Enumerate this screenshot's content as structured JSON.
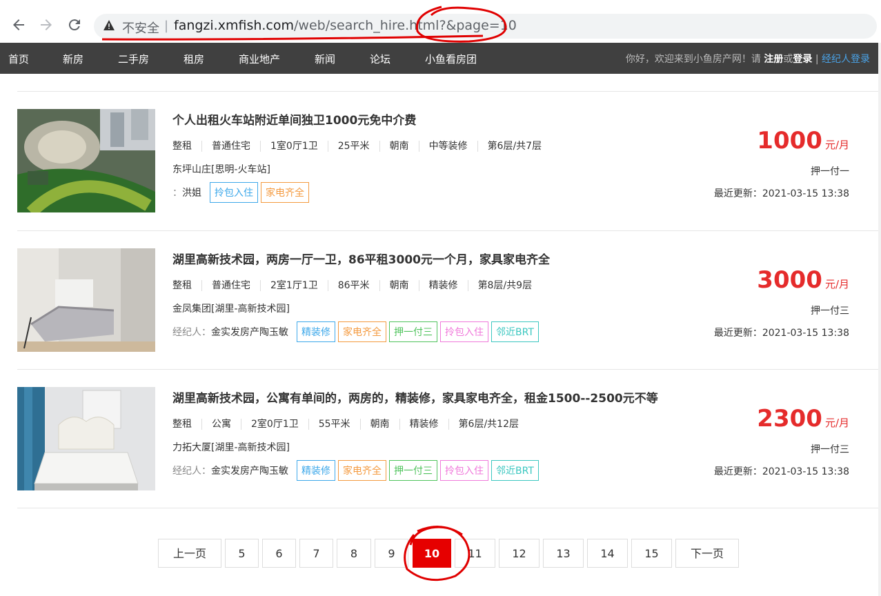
{
  "browser": {
    "back_icon": "back-arrow-icon",
    "forward_icon": "forward-arrow-icon",
    "reload_icon": "reload-icon",
    "security_icon": "warning-triangle-icon",
    "insecure_label": "不安全",
    "separator": "|",
    "url_host": "fangzi.xmfish.com",
    "url_path": "/web/search_hire.html?&page=10"
  },
  "nav": {
    "items": [
      "首页",
      "新房",
      "二手房",
      "租房",
      "商业地产",
      "新闻",
      "论坛",
      "小鱼看房团"
    ],
    "welcome_prefix": "你好，欢迎来到小鱼房产网！请",
    "register": "注册",
    "or": "或",
    "login": "登录",
    "divider": "|",
    "agent_login": "经纪人登录"
  },
  "listings": [
    {
      "title": "个人出租火车站附近单间独卫1000元免中介费",
      "attrs": [
        "整租",
        "普通住宅",
        "1室0厅1卫",
        "25平米",
        "朝南",
        "中等装修",
        "第6层/共7层"
      ],
      "address": "东坪山庄[思明-火车站]",
      "agent_label": "：",
      "agent_name": "洪姐",
      "tags": [
        {
          "text": "拎包入住",
          "color": "#3da8ea"
        },
        {
          "text": "家电齐全",
          "color": "#f49a3f"
        }
      ],
      "price": "1000",
      "unit": "元/月",
      "deposit": "押一付一",
      "updated": "最近更新：2021-03-15 13:38"
    },
    {
      "title": "湖里高新技术园，两房一厅一卫，86平租3000元一个月，家具家电齐全",
      "attrs": [
        "整租",
        "普通住宅",
        "2室1厅1卫",
        "86平米",
        "朝南",
        "精装修",
        "第8层/共9层"
      ],
      "address": "金凤集团[湖里-高新技术园]",
      "agent_label": "经纪人：",
      "agent_name": "金实发房产陶玉敏",
      "tags": [
        {
          "text": "精装修",
          "color": "#3da8ea"
        },
        {
          "text": "家电齐全",
          "color": "#f49a3f"
        },
        {
          "text": "押一付三",
          "color": "#4fc35c"
        },
        {
          "text": "拎包入住",
          "color": "#f07adb"
        },
        {
          "text": "邻近BRT",
          "color": "#3bc7c0"
        }
      ],
      "price": "3000",
      "unit": "元/月",
      "deposit": "押一付三",
      "updated": "最近更新：2021-03-15 13:38"
    },
    {
      "title": "湖里高新技术园，公寓有单间的，两房的，精装修，家具家电齐全，租金1500--2500元不等",
      "attrs": [
        "整租",
        "公寓",
        "2室0厅1卫",
        "55平米",
        "朝南",
        "精装修",
        "第6层/共12层"
      ],
      "address": "力拓大厦[湖里-高新技术园]",
      "agent_label": "经纪人：",
      "agent_name": "金实发房产陶玉敏",
      "tags": [
        {
          "text": "精装修",
          "color": "#3da8ea"
        },
        {
          "text": "家电齐全",
          "color": "#f49a3f"
        },
        {
          "text": "押一付三",
          "color": "#4fc35c"
        },
        {
          "text": "拎包入住",
          "color": "#f07adb"
        },
        {
          "text": "邻近BRT",
          "color": "#3bc7c0"
        }
      ],
      "price": "2300",
      "unit": "元/月",
      "deposit": "押一付三",
      "updated": "最近更新：2021-03-15 13:38"
    }
  ],
  "pagination": {
    "prev": "上一页",
    "pages": [
      "5",
      "6",
      "7",
      "8",
      "9",
      "10",
      "11",
      "12",
      "13",
      "14",
      "15"
    ],
    "current": "10",
    "next": "下一页"
  },
  "colors": {
    "price": "#e52b2b",
    "nav_bg": "#404040",
    "current_page": "#e60000",
    "annotation": "#e00000"
  }
}
